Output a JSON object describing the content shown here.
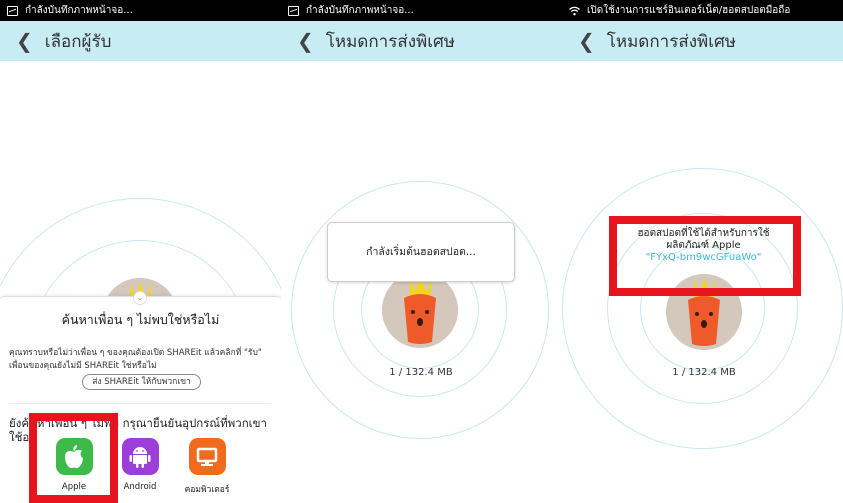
{
  "panel1": {
    "status_text": "กำลังบันทึกภาพหน้าจอ...",
    "title": "เลือกผู้รับ",
    "sheet": {
      "heading": "ค้นหาเพื่อน ๆ ไม่พบใช่หรือไม่",
      "desc_line1": "คุณทราบหรือไม่ว่าเพื่อน ๆ ของคุณต้องเปิด SHAREit แล้วคลิกที่ \"รับ\"",
      "desc_line2": "เพื่อนของคุณยังไม่มี SHAREit ใช่หรือไม่",
      "send_button": "ส่ง SHAREit ให้กับพวกเขา",
      "question": "ยังค้นหาเพื่อน ๆ ไม่พบ กรุณายืนยันอุปกรณ์ที่พวกเขาใช้อยู่",
      "devices": [
        {
          "label": "Apple",
          "icon": "apple-icon",
          "color": "#3dba49"
        },
        {
          "label": "Android",
          "icon": "android-icon",
          "color": "#9b3fd8"
        },
        {
          "label": "คอมพิวเตอร์",
          "icon": "computer-icon",
          "color": "#f26a1b"
        }
      ]
    }
  },
  "panel2": {
    "status_text": "กำลังบันทึกภาพหน้าจอ...",
    "title": "โหมดการส่งพิเศษ",
    "card_text": "กำลังเริ่มต้นฮอตสปอต...",
    "progress": "1 / 132.4 MB"
  },
  "panel3": {
    "status_text": "เปิดใช้งานการแชร์อินเตอร์เน็ต/ฮอตสปอตมือถือ",
    "title": "โหมดการส่งพิเศษ",
    "hotspot_line1": "ฮอตสปอตที่ใช้ได้สำหรับการใช้",
    "hotspot_line2": "ผลิตภัณฑ์ Apple",
    "hotspot_ssid": "\"FYxQ-bm9wcGFuaWo\"",
    "progress": "1 / 132.4 MB"
  },
  "colors": {
    "titlebar": "#c8ecf3",
    "highlight": "#e8141d",
    "ssid": "#3ab8d6"
  }
}
